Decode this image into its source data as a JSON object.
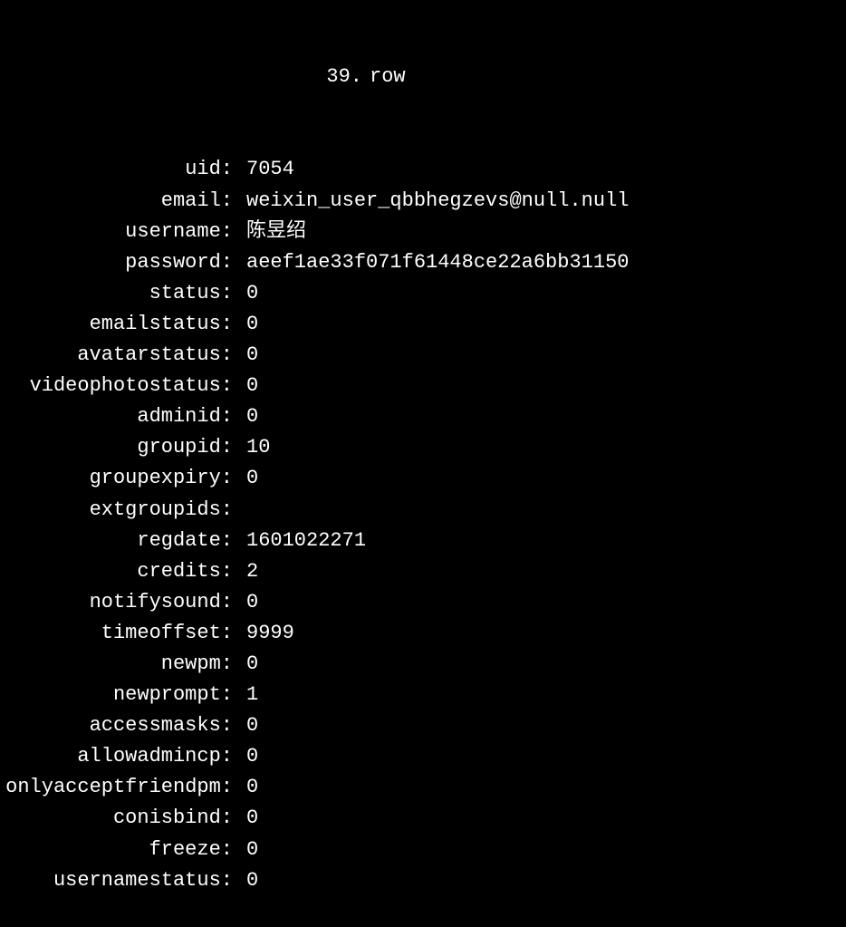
{
  "header": {
    "row_number": "39.",
    "row_label": "row"
  },
  "fields": [
    {
      "label": "uid:",
      "value": "7054"
    },
    {
      "label": "email:",
      "value": "weixin_user_qbbhegzevs@null.null"
    },
    {
      "label": "username:",
      "value": "陈昱绍"
    },
    {
      "label": "password:",
      "value": "aeef1ae33f071f61448ce22a6bb31150"
    },
    {
      "label": "status:",
      "value": "0"
    },
    {
      "label": "emailstatus:",
      "value": "0"
    },
    {
      "label": "avatarstatus:",
      "value": "0"
    },
    {
      "label": "videophotostatus:",
      "value": "0"
    },
    {
      "label": "adminid:",
      "value": "0"
    },
    {
      "label": "groupid:",
      "value": "10"
    },
    {
      "label": "groupexpiry:",
      "value": "0"
    },
    {
      "label": "extgroupids:",
      "value": ""
    },
    {
      "label": "regdate:",
      "value": "1601022271"
    },
    {
      "label": "credits:",
      "value": "2"
    },
    {
      "label": "notifysound:",
      "value": "0"
    },
    {
      "label": "timeoffset:",
      "value": "9999"
    },
    {
      "label": "newpm:",
      "value": "0"
    },
    {
      "label": "newprompt:",
      "value": "1"
    },
    {
      "label": "accessmasks:",
      "value": "0"
    },
    {
      "label": "allowadmincp:",
      "value": "0"
    },
    {
      "label": "onlyacceptfriendpm:",
      "value": "0"
    },
    {
      "label": "conisbind:",
      "value": "0"
    },
    {
      "label": "freeze:",
      "value": "0"
    },
    {
      "label": "usernamestatus:",
      "value": "0"
    }
  ]
}
